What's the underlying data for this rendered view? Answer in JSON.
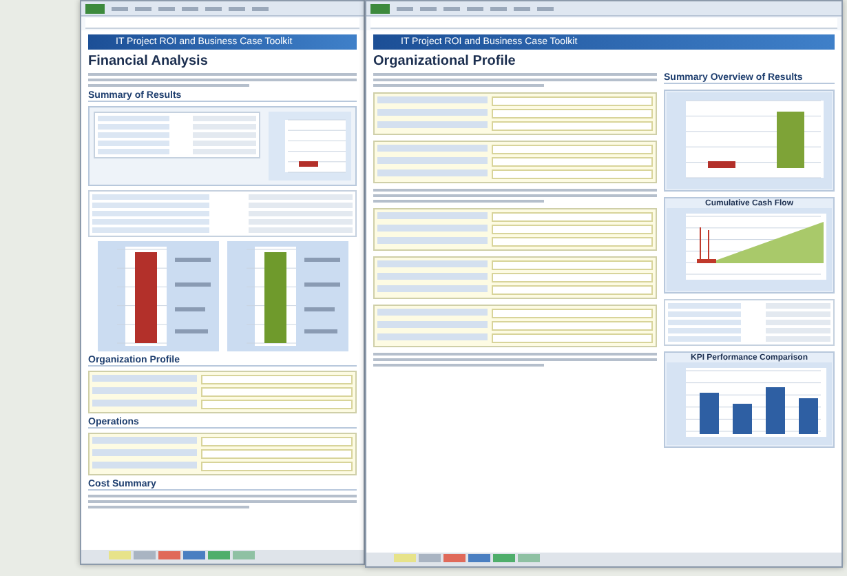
{
  "windows": [
    {
      "banner": "IT Project ROI and Business Case Toolkit",
      "heading": "Financial Analysis",
      "main": [
        {
          "kind": "lines"
        },
        {
          "kind": "section",
          "text": "Summary of Results"
        },
        {
          "kind": "tablechart"
        },
        {
          "kind": "widetable"
        },
        {
          "kind": "gauges",
          "charts": [
            {
              "color": "#b3302a"
            },
            {
              "color": "#6f9a2c"
            }
          ]
        },
        {
          "kind": "section",
          "text": "Organization Profile"
        },
        {
          "kind": "form"
        },
        {
          "kind": "section",
          "text": "Operations"
        },
        {
          "kind": "form"
        },
        {
          "kind": "section",
          "text": "Cost Summary"
        },
        {
          "kind": "lines"
        }
      ]
    },
    {
      "banner": "IT Project ROI and Business Case Toolkit",
      "heading": "Organizational Profile",
      "main": [
        {
          "kind": "lines"
        },
        {
          "kind": "form"
        },
        {
          "kind": "form"
        },
        {
          "kind": "lines"
        },
        {
          "kind": "form"
        },
        {
          "kind": "form"
        },
        {
          "kind": "form"
        },
        {
          "kind": "lines"
        }
      ],
      "side_blocks": [
        {
          "kind": "section",
          "text": "Summary Overview of Results"
        },
        {
          "kind": "summarychart"
        },
        {
          "kind": "areachart",
          "title": "Cumulative Cash Flow"
        },
        {
          "kind": "widetable"
        },
        {
          "kind": "kpichart",
          "title": "KPI Performance Comparison"
        }
      ]
    }
  ]
}
